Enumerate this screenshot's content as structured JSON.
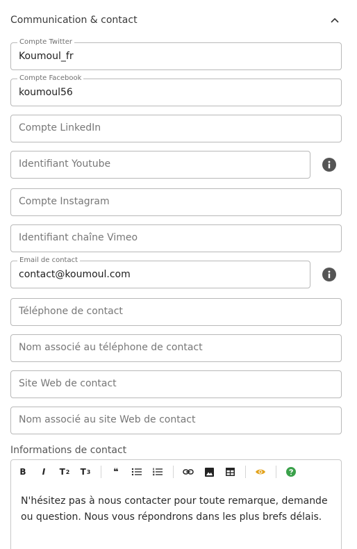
{
  "section": {
    "title": "Communication & contact"
  },
  "fields": {
    "twitter": {
      "label": "Compte Twitter",
      "value": "Koumoul_fr"
    },
    "facebook": {
      "label": "Compte Facebook",
      "value": "koumoul56"
    },
    "linkedin": {
      "placeholder": "Compte LinkedIn"
    },
    "youtube": {
      "placeholder": "Identifiant Youtube"
    },
    "instagram": {
      "placeholder": "Compte Instagram"
    },
    "vimeo": {
      "placeholder": "Identifiant chaîne Vimeo"
    },
    "email": {
      "label": "Email de contact",
      "value": "contact@koumoul.com"
    },
    "phone": {
      "placeholder": "Téléphone de contact"
    },
    "phone_name": {
      "placeholder": "Nom associé au téléphone de contact"
    },
    "website": {
      "placeholder": "Site Web de contact"
    },
    "website_name": {
      "placeholder": "Nom associé au site Web de contact"
    }
  },
  "editor": {
    "label": "Informations de contact",
    "toolbar": {
      "bold": "B",
      "italic": "I",
      "heading2": "T",
      "heading2_sub": "2",
      "heading3": "T",
      "heading3_sub": "3",
      "quote": "❝"
    },
    "content": "N'hésitez pas à nous contacter pour toute remarque, demande ou question. Nous vous répondrons dans les plus brefs délais."
  },
  "colors": {
    "preview_icon": "#e2a21b",
    "help_icon": "#3aa14a",
    "info_icon": "#555555"
  }
}
